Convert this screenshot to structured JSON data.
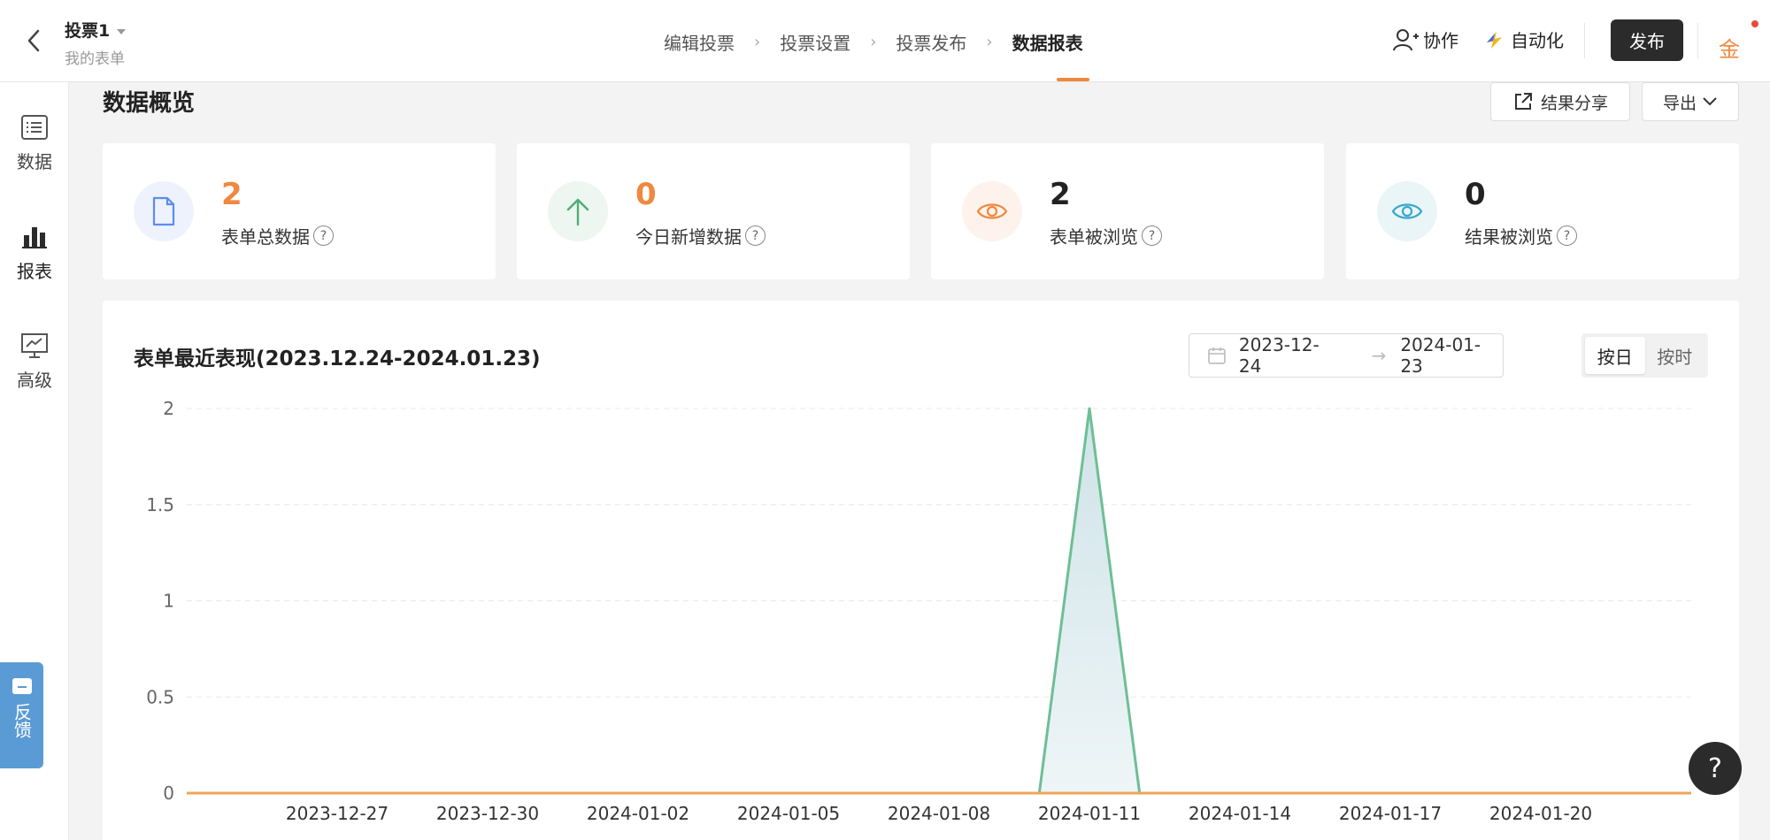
{
  "header": {
    "form_name": "投票1",
    "form_sub": "我的表单",
    "steps": [
      {
        "label": "编辑投票"
      },
      {
        "label": "投票设置"
      },
      {
        "label": "投票发布"
      },
      {
        "label": "数据报表"
      }
    ],
    "collab_label": "协作",
    "auto_label": "自动化",
    "publish_label": "发布",
    "coin_label": "金"
  },
  "sidebar": {
    "items": [
      {
        "label": "数据",
        "icon": "list-icon"
      },
      {
        "label": "报表",
        "icon": "bar-chart-icon"
      },
      {
        "label": "高级",
        "icon": "presentation-icon"
      }
    ],
    "feedback_label": "反馈"
  },
  "overview": {
    "title": "数据概览",
    "share_label": "结果分享",
    "export_label": "导出",
    "cards": [
      {
        "value": "2",
        "label": "表单总数据",
        "icon": "document-icon",
        "color": "#f0883f",
        "icon_color": "#5b8def",
        "bg": "#edf2fd"
      },
      {
        "value": "0",
        "label": "今日新增数据",
        "icon": "arrow-up-icon",
        "color": "#f0883f",
        "icon_color": "#4caf73",
        "bg": "#edf6f0"
      },
      {
        "value": "2",
        "label": "表单被浏览",
        "icon": "eye-icon",
        "color": "#222222",
        "icon_color": "#f0883f",
        "bg": "#fdf3ec"
      },
      {
        "value": "0",
        "label": "结果被浏览",
        "icon": "eye-icon",
        "color": "#222222",
        "icon_color": "#3aa7c9",
        "bg": "#eaf5f8"
      }
    ]
  },
  "chart_panel": {
    "title": "表单最近表现(2023.12.24-2024.01.23)",
    "date_start": "2023-12-24",
    "date_end": "2024-01-23",
    "seg_day": "按日",
    "seg_hour": "按时"
  },
  "chart_data": {
    "type": "area",
    "x": [
      "2023-12-24",
      "2023-12-25",
      "2023-12-26",
      "2023-12-27",
      "2023-12-28",
      "2023-12-29",
      "2023-12-30",
      "2023-12-31",
      "2024-01-01",
      "2024-01-02",
      "2024-01-03",
      "2024-01-04",
      "2024-01-05",
      "2024-01-06",
      "2024-01-07",
      "2024-01-08",
      "2024-01-09",
      "2024-01-10",
      "2024-01-11",
      "2024-01-12",
      "2024-01-13",
      "2024-01-14",
      "2024-01-15",
      "2024-01-16",
      "2024-01-17",
      "2024-01-18",
      "2024-01-19",
      "2024-01-20",
      "2024-01-21",
      "2024-01-22",
      "2024-01-23"
    ],
    "x_tick_labels": [
      "2023-12-27",
      "2023-12-30",
      "2024-01-02",
      "2024-01-05",
      "2024-01-08",
      "2024-01-11",
      "2024-01-14",
      "2024-01-17",
      "2024-01-20"
    ],
    "series": [
      {
        "color": "#6dbf94",
        "values": [
          0,
          0,
          0,
          0,
          0,
          0,
          0,
          0,
          0,
          0,
          0,
          0,
          0,
          0,
          0,
          0,
          0,
          0,
          2,
          0,
          0,
          0,
          0,
          0,
          0,
          0,
          0,
          0,
          0,
          0,
          0
        ]
      },
      {
        "color": "#f0a45a",
        "values": [
          0,
          0,
          0,
          0,
          0,
          0,
          0,
          0,
          0,
          0,
          0,
          0,
          0,
          0,
          0,
          0,
          0,
          0,
          0,
          0,
          0,
          0,
          0,
          0,
          0,
          0,
          0,
          0,
          0,
          0,
          0
        ]
      }
    ],
    "y_ticks": [
      "0",
      "0.5",
      "1",
      "1.5",
      "2"
    ],
    "ylim": [
      0,
      2
    ],
    "grid": true
  }
}
